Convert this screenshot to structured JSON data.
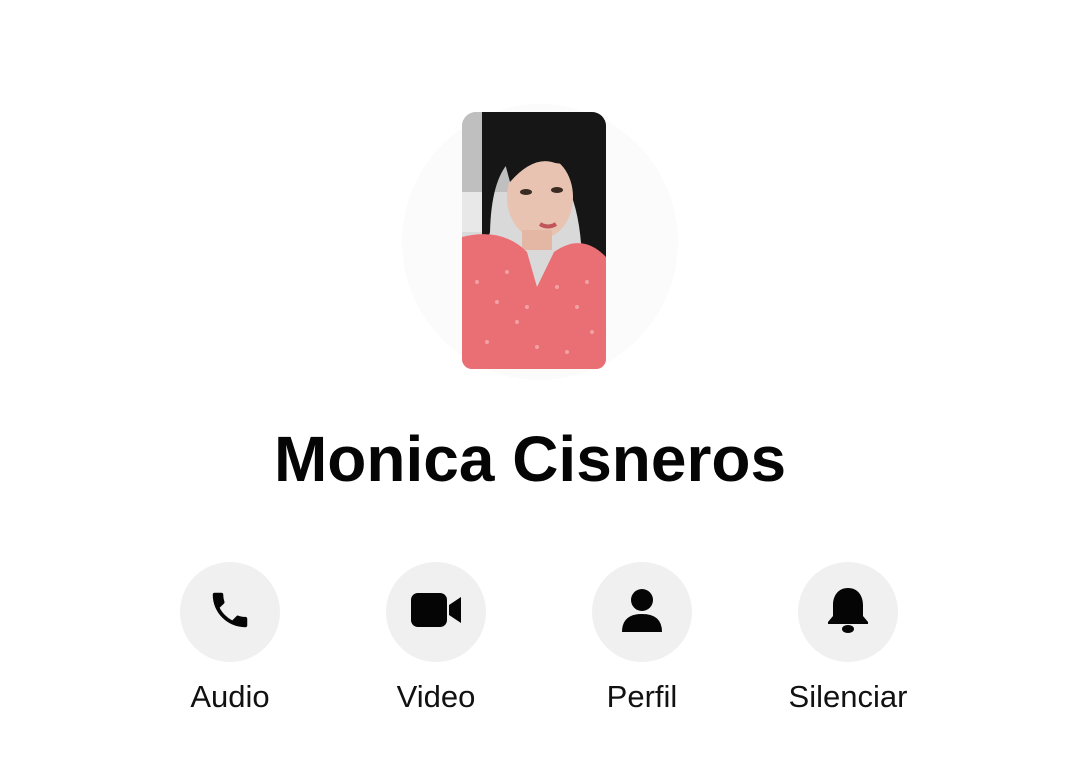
{
  "contact": {
    "name": "Monica Cisneros"
  },
  "actions": [
    {
      "label": "Audio",
      "icon": "phone-icon"
    },
    {
      "label": "Video",
      "icon": "video-camera-icon"
    },
    {
      "label": "Perfil",
      "icon": "profile-icon"
    },
    {
      "label": "Silenciar",
      "icon": "bell-icon"
    }
  ],
  "colors": {
    "background": "#ffffff",
    "text": "#050505",
    "button_background": "#f0f0f0",
    "icon": "#050505"
  }
}
